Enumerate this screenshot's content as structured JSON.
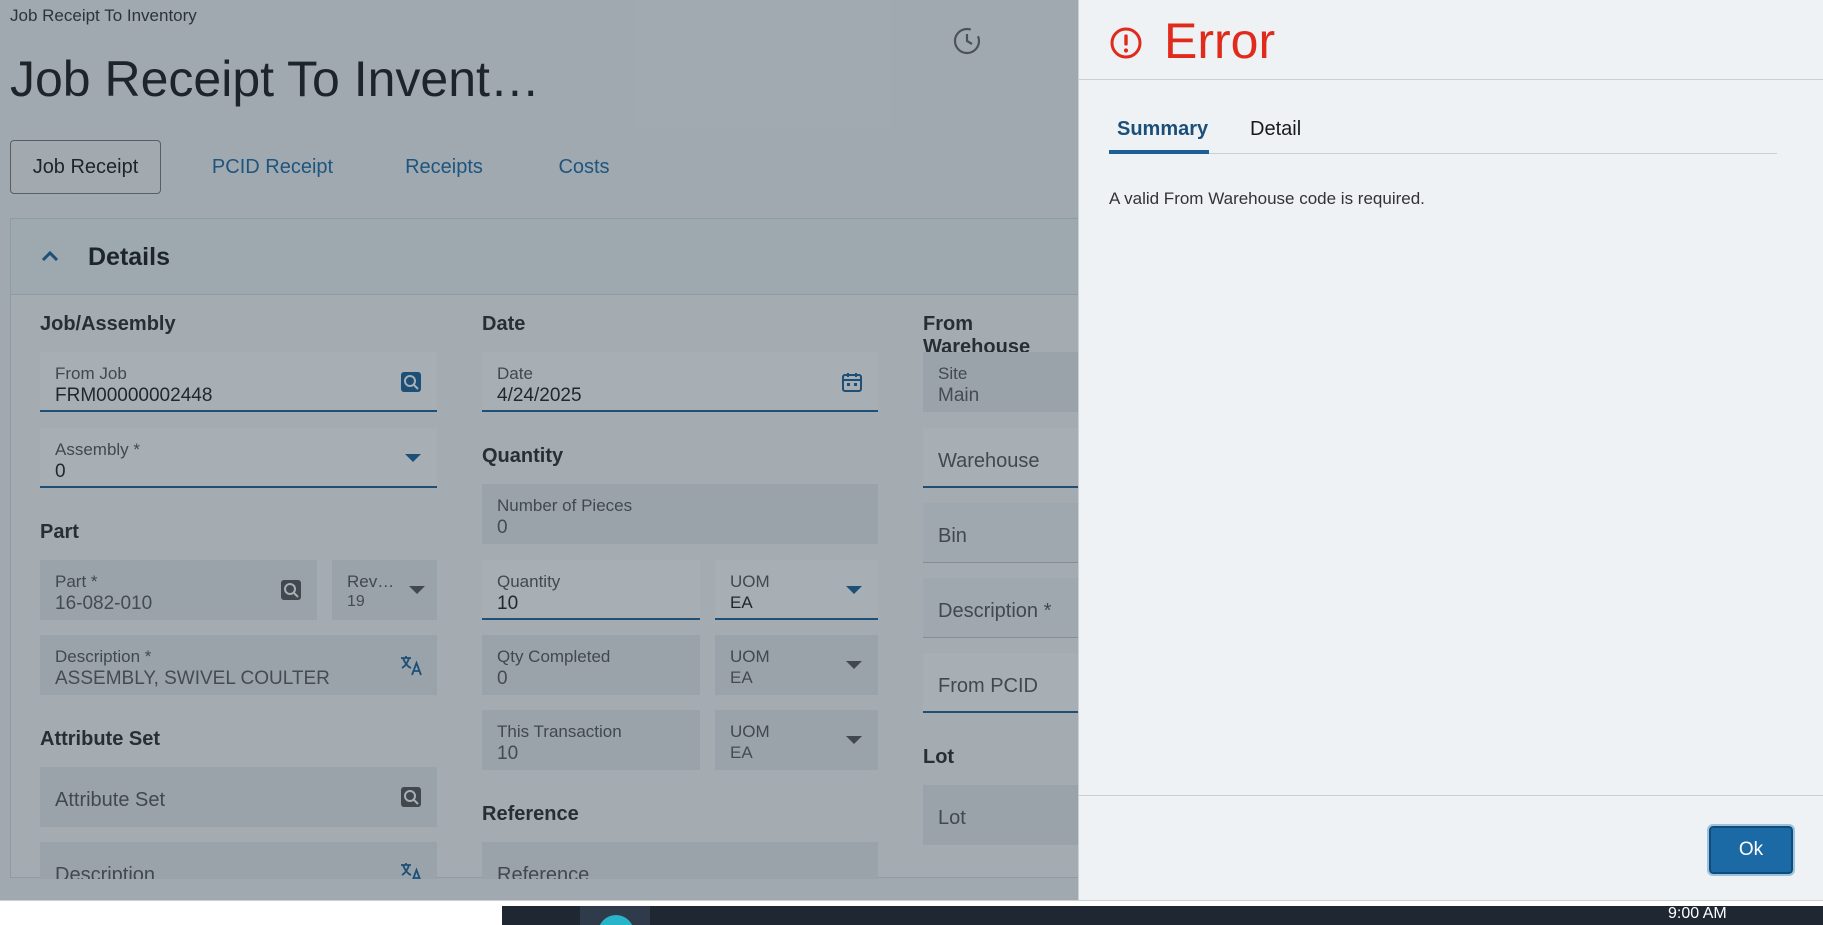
{
  "app": {
    "breadcrumb": "Job Receipt To Inventory",
    "title": "Job Receipt To Invent…",
    "tabs": [
      "Job Receipt",
      "PCID Receipt",
      "Receipts",
      "Costs"
    ],
    "section_title": "Details"
  },
  "job_assembly": {
    "heading": "Job/Assembly",
    "from_job": {
      "label": "From Job",
      "value": "FRM00000002448"
    },
    "assembly": {
      "label": "Assembly *",
      "value": "0"
    }
  },
  "part": {
    "heading": "Part",
    "part": {
      "label": "Part *",
      "value": "16-082-010"
    },
    "rev": {
      "label": "Rev…",
      "value": "19"
    },
    "description": {
      "label": "Description *",
      "value": "ASSEMBLY, SWIVEL COULTER"
    }
  },
  "attribute_set": {
    "heading": "Attribute Set",
    "attribute_set_placeholder": "Attribute Set",
    "description_placeholder": "Description"
  },
  "date": {
    "heading": "Date",
    "date": {
      "label": "Date",
      "value": "4/24/2025"
    }
  },
  "quantity": {
    "heading": "Quantity",
    "pieces": {
      "label": "Number of Pieces",
      "value": "0"
    },
    "qty": {
      "label": "Quantity",
      "value": "10"
    },
    "qty_uom": {
      "label": "UOM",
      "value": "EA"
    },
    "completed": {
      "label": "Qty Completed",
      "value": "0"
    },
    "completed_uom": {
      "label": "UOM",
      "value": "EA"
    },
    "this_txn": {
      "label": "This Transaction",
      "value": "10"
    },
    "this_txn_uom": {
      "label": "UOM",
      "value": "EA"
    }
  },
  "reference": {
    "heading": "Reference",
    "placeholder": "Reference"
  },
  "from_warehouse": {
    "heading": "From Warehouse",
    "site": {
      "label": "Site",
      "value": "Main"
    },
    "warehouse_placeholder": "Warehouse",
    "bin_placeholder": "Bin",
    "description_placeholder": "Description *",
    "pcid_placeholder": "From PCID",
    "lot_heading": "Lot",
    "lot_placeholder": "Lot"
  },
  "error_panel": {
    "title": "Error",
    "tabs": [
      "Summary",
      "Detail"
    ],
    "message": "A valid From Warehouse code is required.",
    "ok_label": "Ok"
  },
  "taskbar": {
    "time": "9:00 AM"
  },
  "colors": {
    "accent": "#1b6aa5",
    "error": "#e02a1b"
  }
}
